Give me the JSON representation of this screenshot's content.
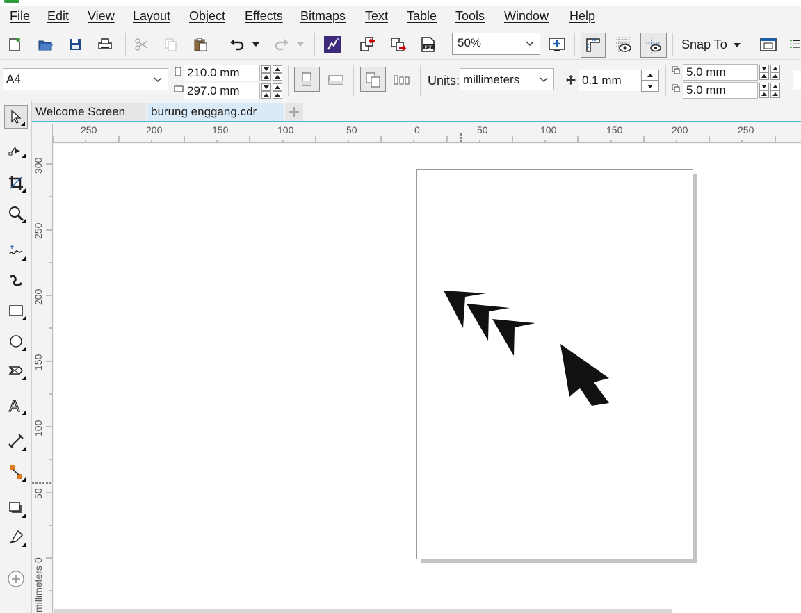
{
  "menu": {
    "file": "File",
    "edit": "Edit",
    "view": "View",
    "layout": "Layout",
    "object": "Object",
    "effects": "Effects",
    "bitmaps": "Bitmaps",
    "text": "Text",
    "table": "Table",
    "tools": "Tools",
    "window": "Window",
    "help": "Help"
  },
  "toolbar": {
    "zoom_value": "50%",
    "snap_to_label": "Snap To"
  },
  "property_bar": {
    "page_size": "A4",
    "width": "210.0 mm",
    "height": "297.0 mm",
    "units_label": "Units:",
    "units_value": "millimeters",
    "nudge": "0.1 mm",
    "dup_x": "5.0 mm",
    "dup_y": "5.0 mm"
  },
  "tabs": [
    {
      "label": "Welcome Screen"
    },
    {
      "label": "burung enggang.cdr"
    }
  ],
  "ruler": {
    "h_labels": [
      "250",
      "200",
      "150",
      "100",
      "50",
      "0",
      "50",
      "100",
      "150",
      "200",
      "250"
    ],
    "v_labels": [
      "300",
      "250",
      "200",
      "150",
      "100",
      "50",
      "0"
    ],
    "units": "millimeters"
  },
  "icons": [
    "new-icon",
    "open-icon",
    "save-icon",
    "print-icon",
    "cut-icon",
    "copy-icon",
    "paste-icon",
    "undo-icon",
    "redo-icon",
    "app-launcher-icon",
    "import-icon",
    "export-icon",
    "publish-pdf-icon",
    "full-screen-preview-icon",
    "rulers-icon",
    "grid-view-icon",
    "guidelines-view-icon",
    "options-icon"
  ],
  "colors": {
    "accent_tab_line": "#4cb8d8",
    "active_tab_bg": "#dbeaf7",
    "shape_fill": "#111111"
  }
}
